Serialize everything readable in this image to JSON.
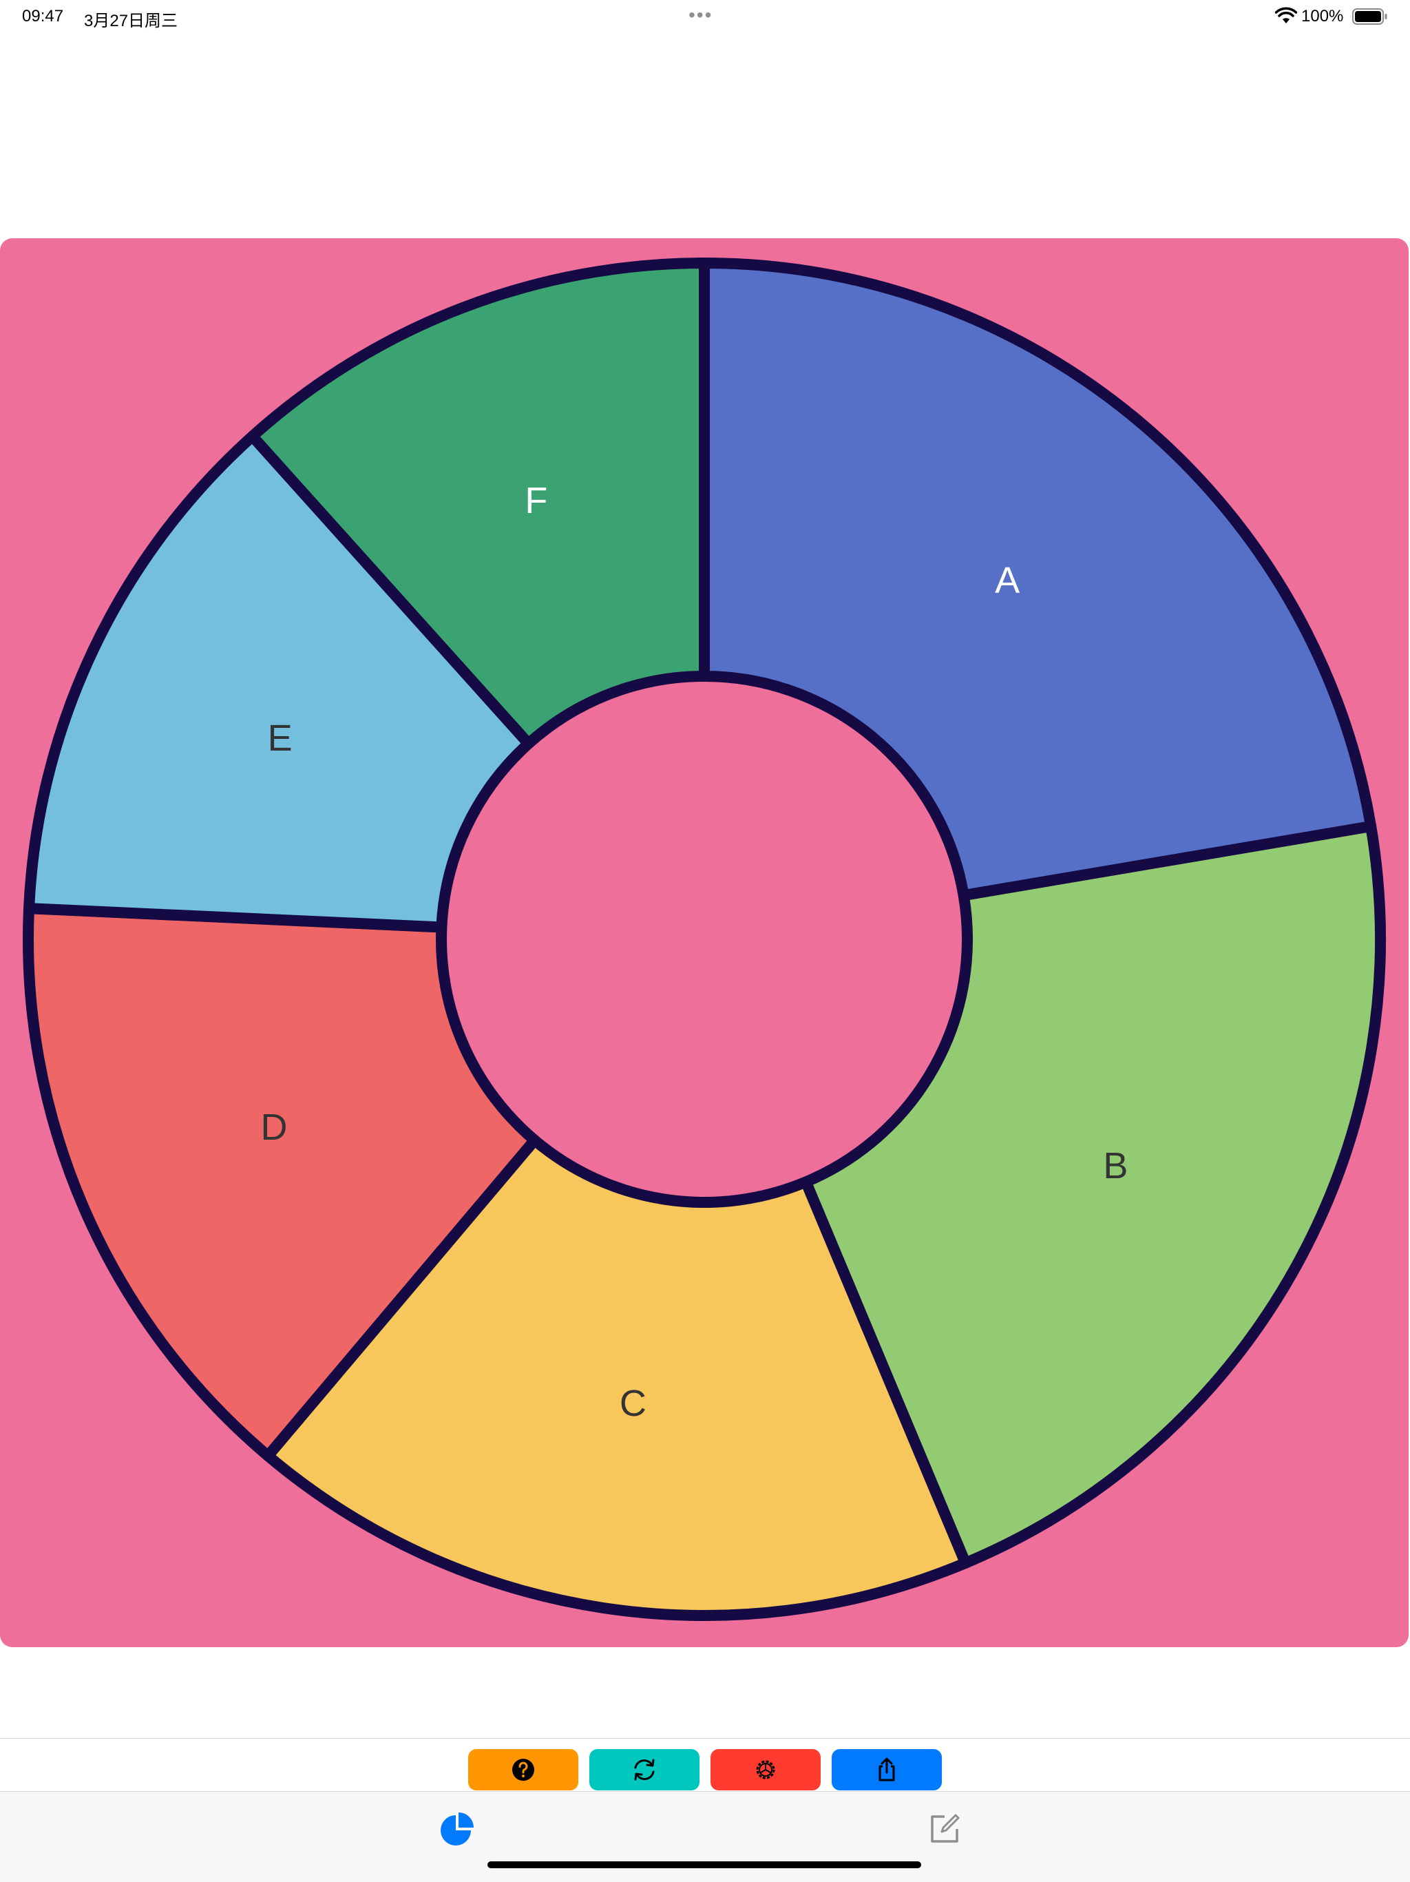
{
  "status_bar": {
    "time": "09:47",
    "date": "3月27日周三",
    "dots": "•••",
    "battery": "100%"
  },
  "colors": {
    "panel_background": "#ef6f9b",
    "segment_stroke": "#160a45",
    "toolbar_help": "#ff9500",
    "toolbar_refresh": "#00c7be",
    "toolbar_settings": "#ff3b30",
    "toolbar_share": "#007aff",
    "tab_active": "#007aff",
    "tab_inactive": "#8e8e93"
  },
  "chart_data": {
    "type": "pie",
    "variant": "donut",
    "title": "",
    "legend": "none",
    "categories": [
      "A",
      "B",
      "C",
      "D",
      "E",
      "F"
    ],
    "values": [
      23,
      22,
      18,
      15,
      13,
      12
    ],
    "colors": [
      "#5570c6",
      "#93cb73",
      "#f8c75b",
      "#ee6666",
      "#73bfdd",
      "#3ba272"
    ],
    "label_colors": [
      "#ffffff",
      "#333333",
      "#333333",
      "#333333",
      "#333333",
      "#ffffff"
    ]
  },
  "toolbar": {
    "buttons": [
      {
        "name": "help",
        "icon": "question-circle-icon"
      },
      {
        "name": "refresh",
        "icon": "refresh-arrows-icon"
      },
      {
        "name": "settings",
        "icon": "gear-icon"
      },
      {
        "name": "share",
        "icon": "share-icon"
      }
    ]
  },
  "tab_bar": {
    "tabs": [
      {
        "name": "chart",
        "icon": "pie-chart-icon",
        "active": true
      },
      {
        "name": "edit",
        "icon": "compose-icon",
        "active": false
      }
    ]
  }
}
